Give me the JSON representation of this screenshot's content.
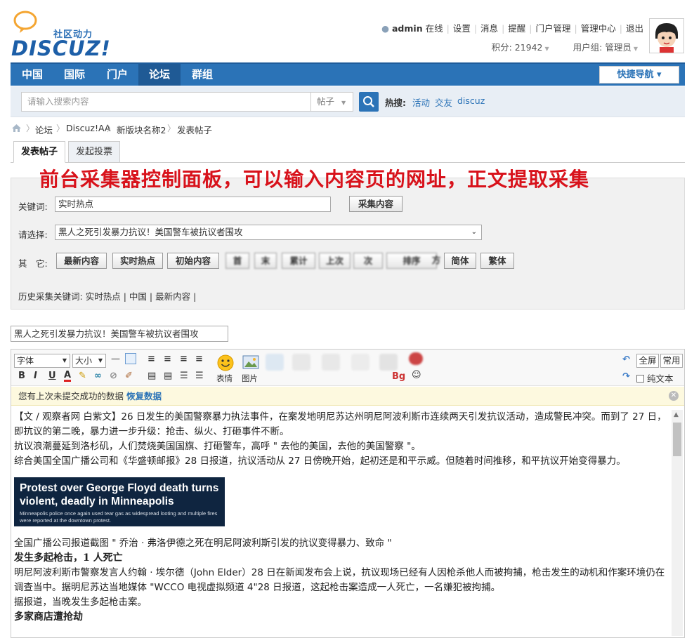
{
  "site": {
    "logo_sub": "社区动力",
    "logo_main": "DISCUZ!"
  },
  "user": {
    "name": "admin",
    "online": "在线",
    "links": [
      "设置",
      "消息",
      "提醒",
      "门户管理",
      "管理中心",
      "退出"
    ],
    "points_label": "积分: 21942",
    "group_label": "用户组: 管理员"
  },
  "nav": {
    "items": [
      "中国",
      "国际",
      "门户",
      "论坛",
      "群组"
    ],
    "active_index": 3,
    "quick_nav": "快捷导航 ▾"
  },
  "search": {
    "placeholder": "请输入搜索内容",
    "type": "帖子",
    "hot_label": "热搜:",
    "hot_links": [
      "活动",
      "交友",
      "discuz"
    ]
  },
  "breadcrumb": [
    "论坛",
    "Discuz!AA",
    "新版块名称2",
    "发表帖子"
  ],
  "tabs": [
    "发表帖子",
    "发起投票"
  ],
  "caption": "前台采集器控制面板，可以输入内容页的网址，正文提取采集",
  "collector": {
    "keyword_label": "关键词:",
    "keyword_value": "实时热点",
    "collect_button": "采集内容",
    "select_label": "请选择:",
    "select_value": "黑人之死引发暴力抗议！美国警车被抗议者围攻",
    "other_label": "其　它:",
    "other_buttons": [
      "最新内容",
      "实时热点",
      "初始内容"
    ],
    "blurred_buttons": [
      "首",
      "末",
      "累计",
      "上次",
      "次",
      "排序",
      "方"
    ],
    "simplified": "简体",
    "traditional": "繁体",
    "history_label": "历史采集关键词:",
    "history_items": [
      "实时热点",
      "中国",
      "最新内容"
    ]
  },
  "post_title": "黑人之死引发暴力抗议！美国警车被抗议者围攻",
  "editor": {
    "font_select": "字体",
    "size_select": "大小",
    "emoji_label": "表情",
    "image_label": "图片",
    "fullscreen": "全屏",
    "common": "常用",
    "plain_text": "纯文本",
    "notice": "您有上次未提交成功的数据",
    "restore": "恢复数据"
  },
  "article": {
    "p1": "【文 / 观察者网 白紫文】26 日发生的美国警察暴力执法事件，在案发地明尼苏达州明尼阿波利斯市连续两天引发抗议活动，造成警民冲突。而到了 27 日，即抗议的第二晚，暴力进一步升级：抢击、纵火、打砸事件不断。",
    "p2": "抗议浪潮蔓延到洛杉矶，人们焚烧美国国旗、打砸警车，高呼 \" 去他的美国，去他的美国警察 \"。",
    "p3": "综合美国全国广播公司和《华盛顿邮报》28 日报道，抗议活动从 27 日傍晚开始，起初还是和平示威。但随着时间推移，和平抗议开始变得暴力。",
    "img_headline": "Protest over George Floyd death turns violent, deadly in Minneapolis",
    "img_sub": "Minneapolis police once again used tear gas as widespread looting and multiple fires were reported at the downtown protest.",
    "p4": "全国广播公司报道截图 \" 乔治 · 弗洛伊德之死在明尼阿波利斯引发的抗议变得暴力、致命 \"",
    "h1": "发生多起枪击，1 人死亡",
    "p5": "明尼阿波利斯市警察发言人约翰 · 埃尔德（John Elder）28 日在新闻发布会上说，抗议现场已经有人因枪杀他人而被拘捕，枪击发生的动机和作案环境仍在调查当中。据明尼苏达当地媒体 \"WCCO 电视虚拟频道 4\"28 日报道，这起枪击案造成一人死亡，一名嫌犯被拘捕。",
    "p6": "据报道，当晚发生多起枪击案。",
    "h2": "多家商店遭抢劫"
  },
  "colors": {
    "nav_blue": "#2b73b7",
    "caption_red": "#d8121b",
    "notice_bg": "#fdf9df"
  }
}
